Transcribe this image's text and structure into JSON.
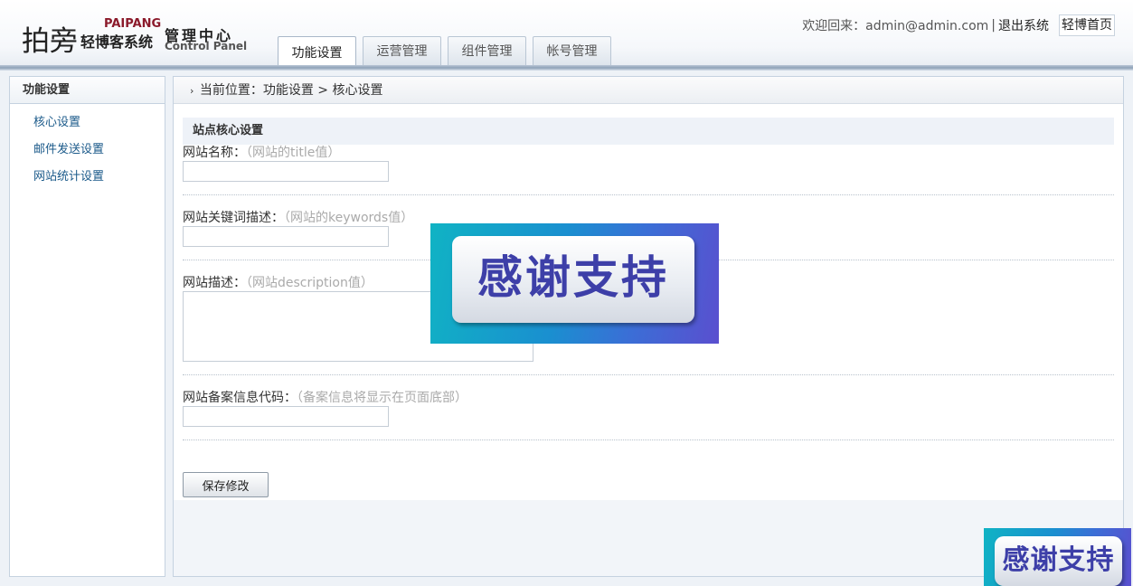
{
  "header": {
    "logo_main": "拍旁",
    "logo_sub": "轻博客系统",
    "logo_en": "PAIPANG",
    "panel_title": "管理中心",
    "panel_sub": "Control Panel",
    "welcome": "欢迎回来：admin@admin.com",
    "separator": "|",
    "logout": "退出系统",
    "home": "轻博首页"
  },
  "tabs": [
    {
      "label": "功能设置",
      "active": true
    },
    {
      "label": "运营管理",
      "active": false
    },
    {
      "label": "组件管理",
      "active": false
    },
    {
      "label": "帐号管理",
      "active": false
    }
  ],
  "sidebar": {
    "title": "功能设置",
    "items": [
      {
        "label": "核心设置"
      },
      {
        "label": "邮件发送设置"
      },
      {
        "label": "网站统计设置"
      }
    ]
  },
  "main": {
    "breadcrumb_arrow": "›",
    "breadcrumb": "当前位置：功能设置 > 核心设置",
    "section_title": "站点核心设置",
    "fields": [
      {
        "label": "网站名称：",
        "hint": "（网站的title值）",
        "value": ""
      },
      {
        "label": "网站关键词描述：",
        "hint": "（网站的keywords值）",
        "value": ""
      },
      {
        "label": "网站描述：",
        "hint": "（网站description值）",
        "value": ""
      },
      {
        "label": "网站备案信息代码：",
        "hint": "（备案信息将显示在页面底部）",
        "value": ""
      }
    ],
    "save_label": "保存修改"
  },
  "banners": {
    "text": "感谢支持"
  },
  "colors": {
    "link": "#1b5a8a",
    "banner_text": "#3d3fa8",
    "logo_en": "#8b1a2b"
  }
}
